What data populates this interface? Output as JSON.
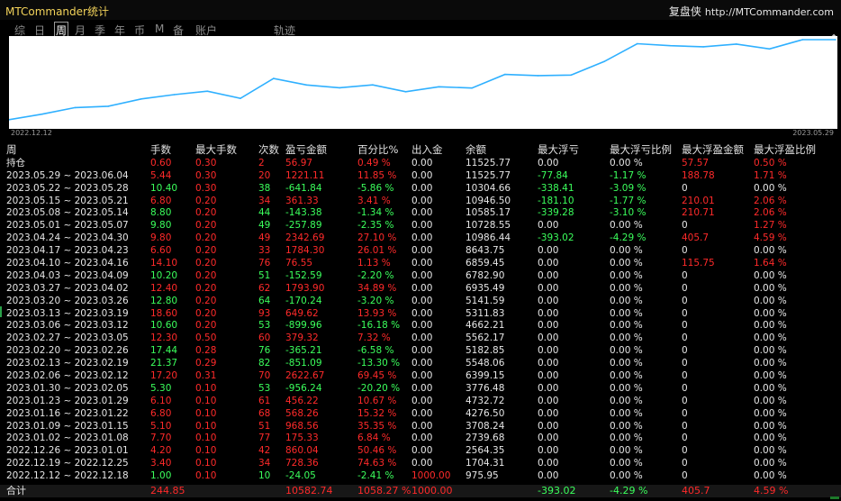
{
  "app": {
    "title": "MTCommander统计",
    "brand_name": "复盘侠",
    "brand_url": "http://MTCommander.com"
  },
  "tabs": [
    {
      "label": "综",
      "active": false
    },
    {
      "label": "日",
      "active": false
    },
    {
      "label": "周",
      "active": true
    },
    {
      "label": "月",
      "active": false
    },
    {
      "label": "季",
      "active": false
    },
    {
      "label": "年",
      "active": false
    },
    {
      "label": "币",
      "active": false
    },
    {
      "label": "M",
      "active": false
    },
    {
      "label": "备",
      "active": false
    },
    {
      "label": "账户",
      "active": false
    },
    {
      "label": "轨迹",
      "active": false
    }
  ],
  "chart_data": {
    "type": "line",
    "x_start_label": "2022.12.12",
    "x_end_label": "2023.05.29",
    "color": "#2fb0ff",
    "x": [
      "2022.12.12",
      "2022.12.19",
      "2022.12.26",
      "2023.01.02",
      "2023.01.09",
      "2023.01.16",
      "2023.01.23",
      "2023.01.30",
      "2023.02.06",
      "2023.02.13",
      "2023.02.20",
      "2023.02.27",
      "2023.03.06",
      "2023.03.13",
      "2023.03.20",
      "2023.03.27",
      "2023.04.03",
      "2023.04.10",
      "2023.04.17",
      "2023.04.24",
      "2023.05.01",
      "2023.05.08",
      "2023.05.15",
      "2023.05.22",
      "2023.05.29",
      "持仓"
    ],
    "balance": [
      975.95,
      1704.31,
      2564.35,
      2739.68,
      3708.24,
      4276.5,
      4732.72,
      3776.48,
      6399.15,
      5548.06,
      5182.85,
      5562.17,
      4662.21,
      5311.83,
      5141.59,
      6935.49,
      6782.9,
      6859.45,
      8643.75,
      10986.44,
      10728.55,
      10585.17,
      10946.5,
      10304.66,
      11525.77,
      11525.77
    ]
  },
  "table": {
    "headers": [
      "周",
      "手数",
      "最大手数",
      "次数",
      "盈亏金额",
      "百分比%",
      "出入金",
      "余额",
      "最大浮亏",
      "最大浮亏比例",
      "最大浮盈金额",
      "最大浮盈比例"
    ],
    "rows": [
      {
        "cells": [
          "持仓",
          "0.60",
          "0.30",
          "2",
          "56.97",
          "0.49 %",
          "0.00",
          "11525.77",
          "0.00",
          "0.00 %",
          "57.57",
          "0.50 %"
        ],
        "color": "red"
      },
      {
        "cells": [
          "2023.05.29 ~ 2023.06.04",
          "5.44",
          "0.30",
          "20",
          "1221.11",
          "11.85 %",
          "0.00",
          "11525.77",
          "-77.84",
          "-1.17 %",
          "188.78",
          "1.71 %"
        ],
        "color": "red"
      },
      {
        "cells": [
          "2023.05.22 ~ 2023.05.28",
          "10.40",
          "0.30",
          "38",
          "-641.84",
          "-5.86 %",
          "0.00",
          "10304.66",
          "-338.41",
          "-3.09 %",
          "0",
          "0.00 %"
        ],
        "color": "green"
      },
      {
        "cells": [
          "2023.05.15 ~ 2023.05.21",
          "6.80",
          "0.20",
          "34",
          "361.33",
          "3.41 %",
          "0.00",
          "10946.50",
          "-181.10",
          "-1.77 %",
          "210.01",
          "2.06 %"
        ],
        "color": "red"
      },
      {
        "cells": [
          "2023.05.08 ~ 2023.05.14",
          "8.80",
          "0.20",
          "44",
          "-143.38",
          "-1.34 %",
          "0.00",
          "10585.17",
          "-339.28",
          "-3.10 %",
          "210.71",
          "2.06 %"
        ],
        "color": "green"
      },
      {
        "cells": [
          "2023.05.01 ~ 2023.05.07",
          "9.80",
          "0.20",
          "49",
          "-257.89",
          "-2.35 %",
          "0.00",
          "10728.55",
          "0.00",
          "0.00 %",
          "0",
          "1.27 %"
        ],
        "color": "green"
      },
      {
        "cells": [
          "2023.04.24 ~ 2023.04.30",
          "9.80",
          "0.20",
          "49",
          "2342.69",
          "27.10 %",
          "0.00",
          "10986.44",
          "-393.02",
          "-4.29 %",
          "405.7",
          "4.59 %"
        ],
        "color": "red"
      },
      {
        "cells": [
          "2023.04.17 ~ 2023.04.23",
          "6.60",
          "0.20",
          "33",
          "1784.30",
          "26.01 %",
          "0.00",
          "8643.75",
          "0.00",
          "0.00 %",
          "0",
          "0.00 %"
        ],
        "color": "red"
      },
      {
        "cells": [
          "2023.04.10 ~ 2023.04.16",
          "14.10",
          "0.20",
          "76",
          "76.55",
          "1.13 %",
          "0.00",
          "6859.45",
          "0.00",
          "0.00 %",
          "115.75",
          "1.64 %"
        ],
        "color": "red"
      },
      {
        "cells": [
          "2023.04.03 ~ 2023.04.09",
          "10.20",
          "0.20",
          "51",
          "-152.59",
          "-2.20 %",
          "0.00",
          "6782.90",
          "0.00",
          "0.00 %",
          "0",
          "0.00 %"
        ],
        "color": "green"
      },
      {
        "cells": [
          "2023.03.27 ~ 2023.04.02",
          "12.40",
          "0.20",
          "62",
          "1793.90",
          "34.89 %",
          "0.00",
          "6935.49",
          "0.00",
          "0.00 %",
          "0",
          "0.00 %"
        ],
        "color": "red"
      },
      {
        "cells": [
          "2023.03.20 ~ 2023.03.26",
          "12.80",
          "0.20",
          "64",
          "-170.24",
          "-3.20 %",
          "0.00",
          "5141.59",
          "0.00",
          "0.00 %",
          "0",
          "0.00 %"
        ],
        "color": "green"
      },
      {
        "cells": [
          "2023.03.13 ~ 2023.03.19",
          "18.60",
          "0.20",
          "93",
          "649.62",
          "13.93 %",
          "0.00",
          "5311.83",
          "0.00",
          "0.00 %",
          "0",
          "0.00 %"
        ],
        "color": "red"
      },
      {
        "cells": [
          "2023.03.06 ~ 2023.03.12",
          "10.60",
          "0.20",
          "53",
          "-899.96",
          "-16.18 %",
          "0.00",
          "4662.21",
          "0.00",
          "0.00 %",
          "0",
          "0.00 %"
        ],
        "color": "green"
      },
      {
        "cells": [
          "2023.02.27 ~ 2023.03.05",
          "12.30",
          "0.50",
          "60",
          "379.32",
          "7.32 %",
          "0.00",
          "5562.17",
          "0.00",
          "0.00 %",
          "0",
          "0.00 %"
        ],
        "color": "red"
      },
      {
        "cells": [
          "2023.02.20 ~ 2023.02.26",
          "17.44",
          "0.28",
          "76",
          "-365.21",
          "-6.58 %",
          "0.00",
          "5182.85",
          "0.00",
          "0.00 %",
          "0",
          "0.00 %"
        ],
        "color": "green"
      },
      {
        "cells": [
          "2023.02.13 ~ 2023.02.19",
          "21.37",
          "0.29",
          "82",
          "-851.09",
          "-13.30 %",
          "0.00",
          "5548.06",
          "0.00",
          "0.00 %",
          "0",
          "0.00 %"
        ],
        "color": "green"
      },
      {
        "cells": [
          "2023.02.06 ~ 2023.02.12",
          "17.20",
          "0.31",
          "70",
          "2622.67",
          "69.45 %",
          "0.00",
          "6399.15",
          "0.00",
          "0.00 %",
          "0",
          "0.00 %"
        ],
        "color": "red"
      },
      {
        "cells": [
          "2023.01.30 ~ 2023.02.05",
          "5.30",
          "0.10",
          "53",
          "-956.24",
          "-20.20 %",
          "0.00",
          "3776.48",
          "0.00",
          "0.00 %",
          "0",
          "0.00 %"
        ],
        "color": "green"
      },
      {
        "cells": [
          "2023.01.23 ~ 2023.01.29",
          "6.10",
          "0.10",
          "61",
          "456.22",
          "10.67 %",
          "0.00",
          "4732.72",
          "0.00",
          "0.00 %",
          "0",
          "0.00 %"
        ],
        "color": "red"
      },
      {
        "cells": [
          "2023.01.16 ~ 2023.01.22",
          "6.80",
          "0.10",
          "68",
          "568.26",
          "15.32 %",
          "0.00",
          "4276.50",
          "0.00",
          "0.00 %",
          "0",
          "0.00 %"
        ],
        "color": "red"
      },
      {
        "cells": [
          "2023.01.09 ~ 2023.01.15",
          "5.10",
          "0.10",
          "51",
          "968.56",
          "35.35 %",
          "0.00",
          "3708.24",
          "0.00",
          "0.00 %",
          "0",
          "0.00 %"
        ],
        "color": "red"
      },
      {
        "cells": [
          "2023.01.02 ~ 2023.01.08",
          "7.70",
          "0.10",
          "77",
          "175.33",
          "6.84 %",
          "0.00",
          "2739.68",
          "0.00",
          "0.00 %",
          "0",
          "0.00 %"
        ],
        "color": "red"
      },
      {
        "cells": [
          "2022.12.26 ~ 2023.01.01",
          "4.20",
          "0.10",
          "42",
          "860.04",
          "50.46 %",
          "0.00",
          "2564.35",
          "0.00",
          "0.00 %",
          "0",
          "0.00 %"
        ],
        "color": "red"
      },
      {
        "cells": [
          "2022.12.19 ~ 2022.12.25",
          "3.40",
          "0.10",
          "34",
          "728.36",
          "74.63 %",
          "0.00",
          "1704.31",
          "0.00",
          "0.00 %",
          "0",
          "0.00 %"
        ],
        "color": "red"
      },
      {
        "cells": [
          "2022.12.12 ~ 2022.12.18",
          "1.00",
          "0.10",
          "10",
          "-24.05",
          "-2.41 %",
          "1000.00",
          "975.95",
          "0.00",
          "0.00 %",
          "0",
          "0.00 %"
        ],
        "color": "green"
      }
    ],
    "total": {
      "label": "合计",
      "lots": "244.85",
      "pnl": "10582.74",
      "pct": "1058.27 %",
      "deposit": "1000.00",
      "max_float_loss": "-393.02",
      "max_float_loss_pct": "-4.29 %",
      "max_float_profit": "405.7",
      "max_float_profit_pct": "4.59 %"
    }
  }
}
